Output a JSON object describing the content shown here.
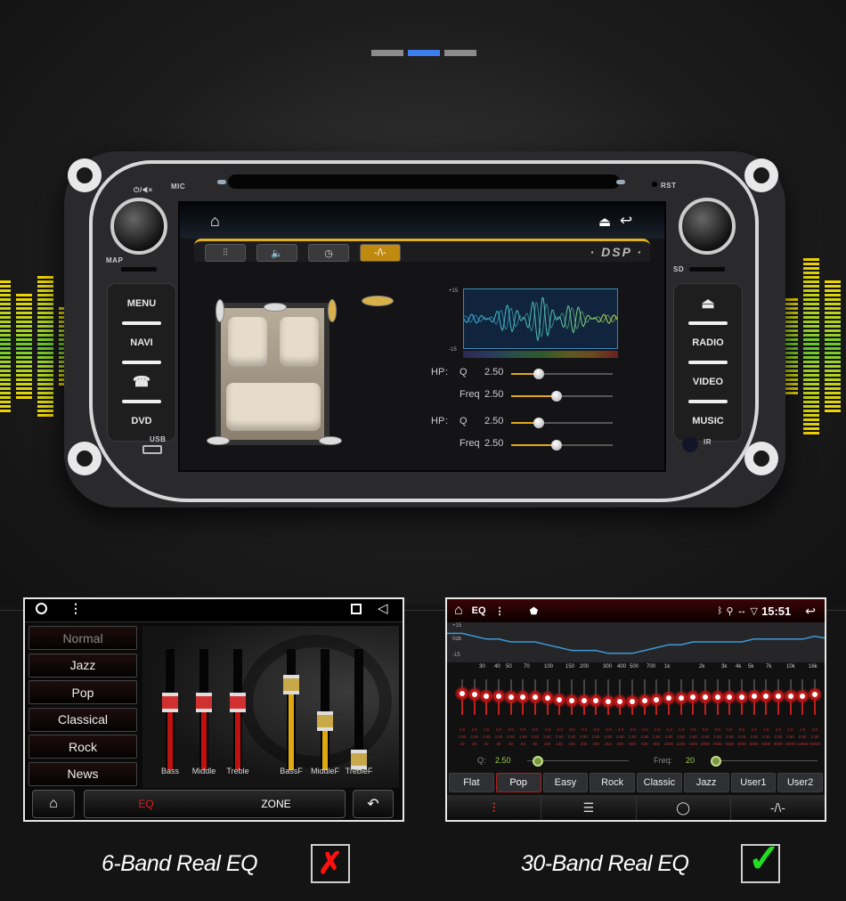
{
  "pager": {
    "pages": 3,
    "active": 2
  },
  "unit": {
    "labels": {
      "power": "⏻/◀×",
      "mic": "MIC",
      "rst": "RST",
      "map": "MAP",
      "sd": "SD",
      "usb": "USB",
      "ir": "IR"
    },
    "left_buttons": [
      "MENU",
      "NAVI",
      "☎",
      "DVD"
    ],
    "right_buttons": [
      "⏏",
      "RADIO",
      "VIDEO",
      "MUSIC"
    ]
  },
  "dsp_screen": {
    "title": "· DSP ·",
    "tabs": [
      {
        "icon": "equalizer-sliders-icon",
        "glyph": "⫶⫶",
        "active": false
      },
      {
        "icon": "speaker-icon",
        "glyph": "🔈",
        "active": false
      },
      {
        "icon": "clock-icon",
        "glyph": "◷",
        "active": false
      },
      {
        "icon": "waveform-icon",
        "glyph": "-/\\-",
        "active": true
      }
    ],
    "wave_top_label": "+15",
    "wave_bottom_label": "-15",
    "params": [
      {
        "group": "HP",
        "sep": ":",
        "name": "Q",
        "value": "2.50",
        "level": 0.27
      },
      {
        "group": "",
        "sep": "",
        "name": "Freq",
        "value": "2.50",
        "level": 0.45
      },
      {
        "group": "HP",
        "sep": ":",
        "name": "Q",
        "value": "2.50",
        "level": 0.27
      },
      {
        "group": "",
        "sep": "",
        "name": "Freq",
        "value": "2.50",
        "level": 0.45
      }
    ]
  },
  "panel_6band": {
    "presets": [
      "Normal",
      "Jazz",
      "Pop",
      "Classical",
      "Rock",
      "News"
    ],
    "selected_preset": "Normal",
    "faders": [
      {
        "label": "Bass",
        "level": 0.55,
        "color": "#c01010"
      },
      {
        "label": "Middle",
        "level": 0.55,
        "color": "#c01010"
      },
      {
        "label": "Treble",
        "level": 0.55,
        "color": "#c01010"
      },
      {
        "label": "BassF",
        "level": 0.7,
        "color": "#e0a810"
      },
      {
        "label": "MiddleF",
        "level": 0.4,
        "color": "#e0a810"
      },
      {
        "label": "TrebleF",
        "level": 0.08,
        "color": "#e0a810"
      }
    ],
    "footer": {
      "eq_label": "EQ",
      "zone_label": "ZONE"
    }
  },
  "panel_30band": {
    "status": {
      "app": "EQ",
      "time": "15:51"
    },
    "graph": {
      "top": "+15",
      "mid": "0db",
      "bottom": "-15"
    },
    "freq_ticks": [
      "30",
      "40",
      "50",
      "70",
      "100",
      "150",
      "200",
      "300",
      "400",
      "500",
      "700",
      "1k",
      "2k",
      "3k",
      "4k",
      "5k",
      "7k",
      "10k",
      "16k"
    ],
    "bands": [
      {
        "gain": "3.0",
        "q": "2.50",
        "freq": "20"
      },
      {
        "gain": "2.0",
        "q": "2.50",
        "freq": "25"
      },
      {
        "gain": "1.0",
        "q": "2.50",
        "freq": "32"
      },
      {
        "gain": "1.0",
        "q": "2.50",
        "freq": "40"
      },
      {
        "gain": "0.0",
        "q": "2.50",
        "freq": "50"
      },
      {
        "gain": "0.0",
        "q": "2.50",
        "freq": "63"
      },
      {
        "gain": "0.0",
        "q": "2.50",
        "freq": "80"
      },
      {
        "gain": "-1.0",
        "q": "2.50",
        "freq": "100"
      },
      {
        "gain": "-2.0",
        "q": "2.50",
        "freq": "125"
      },
      {
        "gain": "-3.0",
        "q": "2.50",
        "freq": "160"
      },
      {
        "gain": "-3.0",
        "q": "2.50",
        "freq": "200"
      },
      {
        "gain": "-3.0",
        "q": "2.50",
        "freq": "250"
      },
      {
        "gain": "-4.0",
        "q": "2.50",
        "freq": "315"
      },
      {
        "gain": "-4.0",
        "q": "2.50",
        "freq": "400"
      },
      {
        "gain": "-4.0",
        "q": "2.50",
        "freq": "500"
      },
      {
        "gain": "-3.0",
        "q": "2.50",
        "freq": "630"
      },
      {
        "gain": "-2.0",
        "q": "2.50",
        "freq": "800"
      },
      {
        "gain": "-1.0",
        "q": "2.50",
        "freq": "1000"
      },
      {
        "gain": "-1.0",
        "q": "2.50",
        "freq": "1250"
      },
      {
        "gain": "0.0",
        "q": "2.50",
        "freq": "1600"
      },
      {
        "gain": "0.0",
        "q": "2.50",
        "freq": "2000"
      },
      {
        "gain": "0.0",
        "q": "2.50",
        "freq": "2500"
      },
      {
        "gain": "0.0",
        "q": "2.50",
        "freq": "3150"
      },
      {
        "gain": "0.0",
        "q": "2.50",
        "freq": "4000"
      },
      {
        "gain": "1.0",
        "q": "2.50",
        "freq": "5000"
      },
      {
        "gain": "1.0",
        "q": "2.50",
        "freq": "6300"
      },
      {
        "gain": "1.0",
        "q": "2.50",
        "freq": "8000"
      },
      {
        "gain": "1.0",
        "q": "2.50",
        "freq": "10000"
      },
      {
        "gain": "1.0",
        "q": "2.50",
        "freq": "12500"
      },
      {
        "gain": "2.0",
        "q": "2.50",
        "freq": "16000"
      }
    ],
    "q_label": "Q:",
    "q_value": "2.50",
    "freq_label": "Freq:",
    "freq_value": "20",
    "presets": [
      "Flat",
      "Pop",
      "Easy",
      "Rock",
      "Classic",
      "Jazz",
      "User1",
      "User2"
    ],
    "selected_preset": "Pop",
    "nav": [
      {
        "icon": "eq-mixer-icon",
        "glyph": "⫶",
        "active": true
      },
      {
        "icon": "bars-icon",
        "glyph": "☰",
        "active": false
      },
      {
        "icon": "circle-target-icon",
        "glyph": "◯",
        "active": false
      },
      {
        "icon": "waveform-icon",
        "glyph": "-/\\-",
        "active": false
      }
    ]
  },
  "captions": {
    "left": "6-Band Real EQ",
    "left_mark": "✗",
    "right": "30-Band Real EQ",
    "right_mark": "✓"
  },
  "colors": {
    "accent_blue": "#3c7ef0",
    "dsp_gold": "#e0b020",
    "eq_red": "#c01818",
    "check_green": "#22dd22",
    "cross_red": "#ff1010"
  }
}
